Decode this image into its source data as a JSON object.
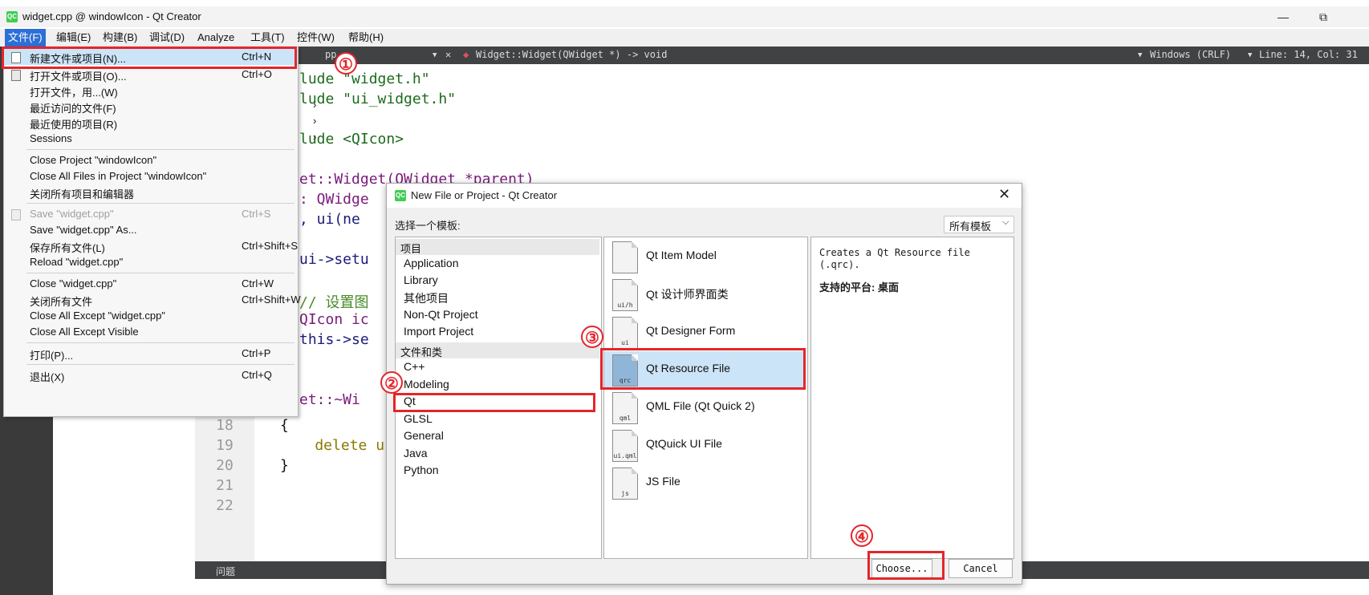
{
  "window": {
    "title": "widget.cpp @ windowIcon - Qt Creator",
    "logo": "QC",
    "minimize": "—",
    "restore": "⧉",
    "close": "✕"
  },
  "menubar": [
    "文件(F)",
    "编辑(E)",
    "构建(B)",
    "调试(D)",
    "Analyze",
    "工具(T)",
    "控件(W)",
    "帮助(H)"
  ],
  "editor_toolbar": {
    "file_frag": "pp",
    "function": "Widget::Widget(QWidget *) -> void",
    "line_ending": "Windows (CRLF)",
    "position": "Line: 14, Col: 31"
  },
  "code_lines": [
    {
      "text": "lude \"widget.h\""
    },
    {
      "text": "lude \"ui_widget.h\""
    },
    {
      "text": "lude <QIcon>"
    },
    {
      "text": "et::Widget(QWidget *parent)"
    },
    {
      "text": ": QWidge"
    },
    {
      "text": ", ui(ne"
    },
    {
      "text": "ui->setu"
    },
    {
      "text": "// 设置图"
    },
    {
      "text": "QIcon ic"
    },
    {
      "text": "this->se"
    },
    {
      "text": "et::~Wi"
    }
  ],
  "code_tail": [
    {
      "num": "18",
      "text": "{"
    },
    {
      "num": "19",
      "text": "    delete u"
    },
    {
      "num": "20",
      "text": "}"
    },
    {
      "num": "21",
      "text": ""
    },
    {
      "num": "22",
      "text": ""
    }
  ],
  "bottom_pane": {
    "label": "问题"
  },
  "file_menu": {
    "items": [
      {
        "label": "新建文件或项目(N)...",
        "shortcut": "Ctrl+N"
      },
      {
        "label": "打开文件或项目(O)...",
        "shortcut": "Ctrl+O"
      },
      {
        "label": "打开文件，用...(W)",
        "shortcut": ""
      },
      {
        "label": "最近访问的文件(F)",
        "shortcut": "",
        "submenu": "›"
      },
      {
        "label": "最近使用的项目(R)",
        "shortcut": "",
        "submenu": "›"
      },
      {
        "label": "Sessions",
        "shortcut": "",
        "submenu": "›"
      },
      {
        "label": "Close Project \"windowIcon\"",
        "shortcut": ""
      },
      {
        "label": "Close All Files in Project \"windowIcon\"",
        "shortcut": ""
      },
      {
        "label": "关闭所有项目和编辑器",
        "shortcut": ""
      },
      {
        "label": "Save \"widget.cpp\"",
        "shortcut": "Ctrl+S"
      },
      {
        "label": "Save \"widget.cpp\" As...",
        "shortcut": ""
      },
      {
        "label": "保存所有文件(L)",
        "shortcut": "Ctrl+Shift+S"
      },
      {
        "label": "Reload \"widget.cpp\"",
        "shortcut": ""
      },
      {
        "label": "Close \"widget.cpp\"",
        "shortcut": "Ctrl+W"
      },
      {
        "label": "关闭所有文件",
        "shortcut": "Ctrl+Shift+W"
      },
      {
        "label": "Close All Except \"widget.cpp\"",
        "shortcut": ""
      },
      {
        "label": "Close All Except Visible",
        "shortcut": ""
      },
      {
        "label": "打印(P)...",
        "shortcut": "Ctrl+P"
      },
      {
        "label": "退出(X)",
        "shortcut": "Ctrl+Q"
      }
    ]
  },
  "dialog": {
    "logo": "QC",
    "title": "New File or Project - Qt Creator",
    "close": "✕",
    "prompt": "选择一个模板:",
    "filter": "所有模板",
    "filter_arrow": "⌵",
    "categories": {
      "group1": "项目",
      "group1_items": [
        "Application",
        "Library",
        "其他项目",
        "Non-Qt Project",
        "Import Project"
      ],
      "group2": "文件和类",
      "group2_items": [
        "C++",
        "Modeling",
        "Qt",
        "GLSL",
        "General",
        "Java",
        "Python"
      ]
    },
    "templates": [
      {
        "label": "Qt Item Model",
        "tag": ""
      },
      {
        "label": "Qt 设计师界面类",
        "tag": "ui/h"
      },
      {
        "label": "Qt Designer Form",
        "tag": "ui"
      },
      {
        "label": "Qt Resource File",
        "tag": "qrc"
      },
      {
        "label": "QML File (Qt Quick 2)",
        "tag": "qml"
      },
      {
        "label": "QtQuick UI File",
        "tag": "ui.qml"
      },
      {
        "label": "JS File",
        "tag": "js"
      }
    ],
    "description": "Creates a Qt Resource file (.qrc).",
    "platforms": "支持的平台: 桌面",
    "choose": "Choose...",
    "cancel": "Cancel"
  },
  "annotations": {
    "m1": "①",
    "m2": "②",
    "m3": "③",
    "m4": "④",
    "accent": "#e3262b"
  }
}
